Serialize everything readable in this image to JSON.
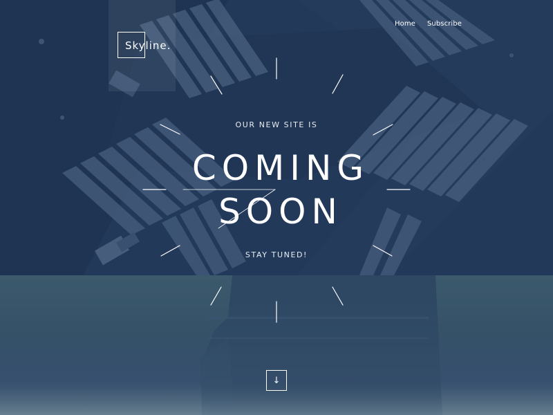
{
  "brand": {
    "name": "Skyline."
  },
  "nav": {
    "items": [
      {
        "label": "Home"
      },
      {
        "label": "Subscribe"
      }
    ]
  },
  "hero": {
    "eyebrow": "OUR NEW SITE IS",
    "headline_line1": "COMING",
    "headline_line2": "SOON",
    "tagline": "STAY TUNED!"
  },
  "scroll_button": {
    "icon": "arrow-down-icon",
    "glyph": "↓"
  },
  "colors": {
    "overlay_top": "#22395a",
    "overlay_bottom": "#3c5a6c",
    "text": "#ffffff"
  }
}
